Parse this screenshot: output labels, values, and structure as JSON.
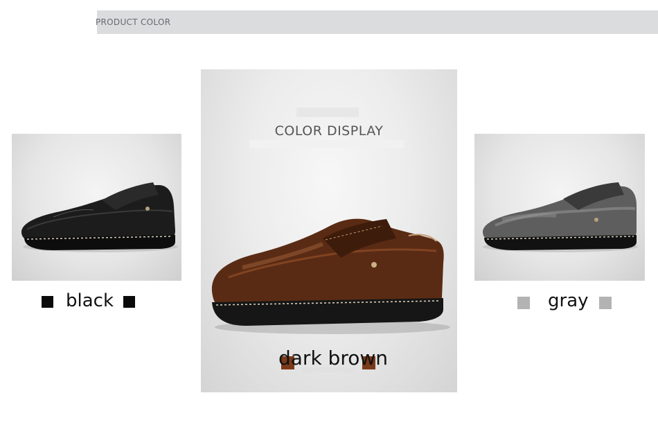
{
  "header": {
    "title": "PRODUCT COLOR"
  },
  "display": {
    "title": "COLOR DISPLAY"
  },
  "colors": {
    "black": {
      "label": "black",
      "swatch": "#0a0a0a",
      "icon": "black-square-icon"
    },
    "dark_brown": {
      "label": "dark brown",
      "swatch": "#7a3a1a",
      "icon": "brown-square-icon"
    },
    "gray": {
      "label": "gray",
      "swatch": "#b3b3b3",
      "icon": "gray-square-icon"
    }
  }
}
